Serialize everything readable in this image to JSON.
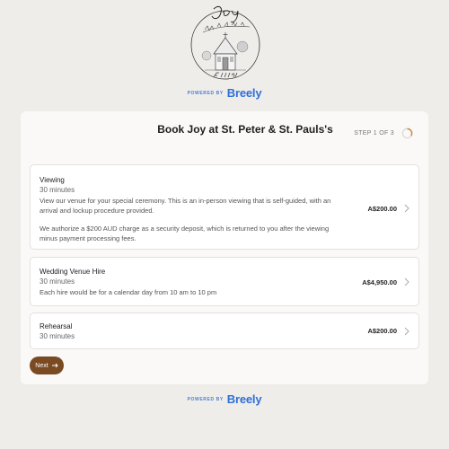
{
  "powered_by": {
    "label": "POWERED BY",
    "brand": "Breely"
  },
  "booking": {
    "title": "Book Joy at St. Peter & St. Pauls's",
    "step": "STEP 1 OF 3",
    "step_progress": 0.333
  },
  "options": [
    {
      "name": "Viewing",
      "duration": "30 minutes",
      "desc1": "View our venue for your special ceremony. This is an in-person viewing that is self-guided, with an arrival and lockup procedure provided.",
      "desc2": "We authorize a $200 AUD charge as a security deposit, which is returned to you after the viewing minus payment processing fees.",
      "price": "A$200.00"
    },
    {
      "name": "Wedding Venue Hire",
      "duration": "30 minutes",
      "desc1": "Each hire would be for a calendar day from 10 am to 10 pm",
      "price": "A$4,950.00"
    },
    {
      "name": "Rehearsal",
      "duration": "30 minutes",
      "price": "A$200.00"
    }
  ],
  "next_button": {
    "label": "Next",
    "color": "#7a4a22"
  },
  "brand_color": "#2e6fd8"
}
